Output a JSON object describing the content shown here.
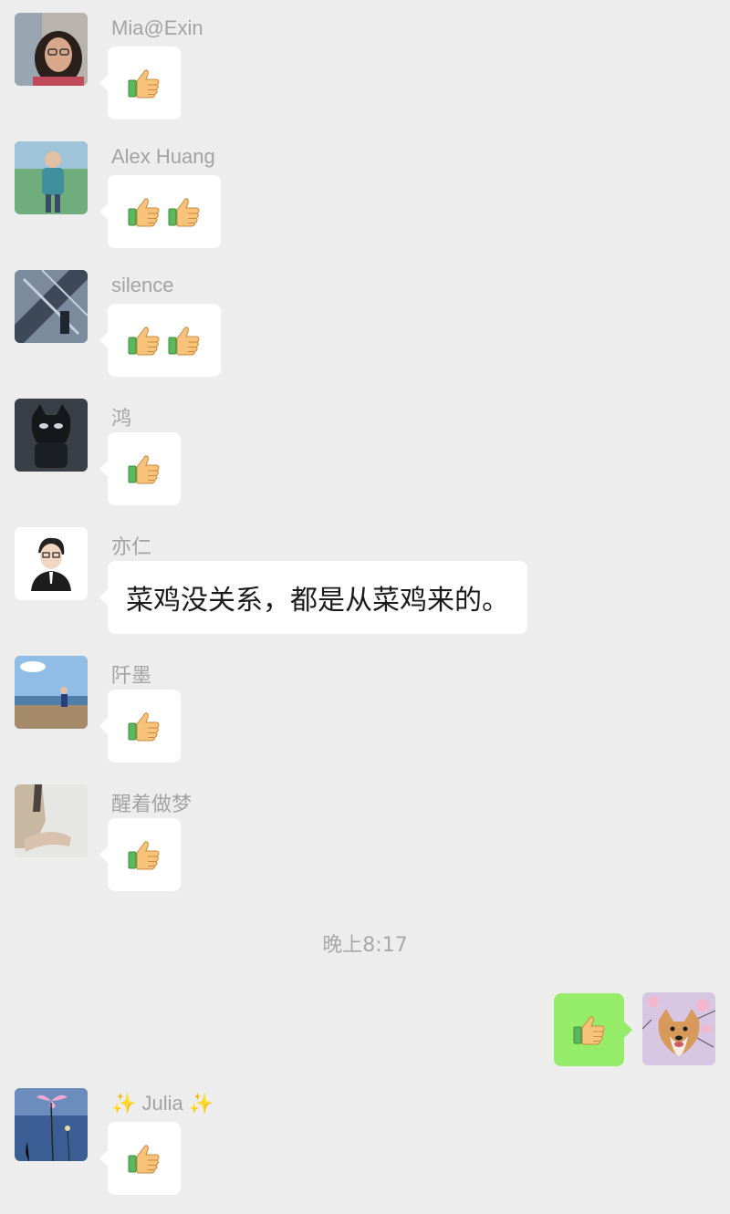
{
  "messages": [
    {
      "sender": "Mia@Exin",
      "content": "emoji",
      "emoji": [
        "thumbs-up-icon"
      ]
    },
    {
      "sender": "Alex Huang",
      "content": "emoji",
      "emoji": [
        "thumbs-up-icon",
        "thumbs-up-icon"
      ]
    },
    {
      "sender": "silence",
      "content": "emoji",
      "emoji": [
        "thumbs-up-icon",
        "thumbs-up-icon"
      ]
    },
    {
      "sender": "鸿",
      "content": "emoji",
      "emoji": [
        "thumbs-up-icon"
      ]
    },
    {
      "sender": "亦仁",
      "content": "text",
      "text": "菜鸡没关系，都是从菜鸡来的。"
    },
    {
      "sender": "阡墨",
      "content": "emoji",
      "emoji": [
        "thumbs-up-icon"
      ]
    },
    {
      "sender": "醒着做梦",
      "content": "emoji",
      "emoji": [
        "thumbs-up-icon"
      ]
    }
  ],
  "timestamp": "晚上8:17",
  "self_message": {
    "emoji": [
      "thumbs-up-icon"
    ]
  },
  "last_message": {
    "sender_sparkle_left": "✨",
    "sender": "Julia",
    "sender_sparkle_right": "✨",
    "emoji": [
      "thumbs-up-icon"
    ]
  },
  "colors": {
    "background": "#ededed",
    "bubble": "#ffffff",
    "self_bubble": "#95ec69",
    "name": "#a3a3a3"
  }
}
